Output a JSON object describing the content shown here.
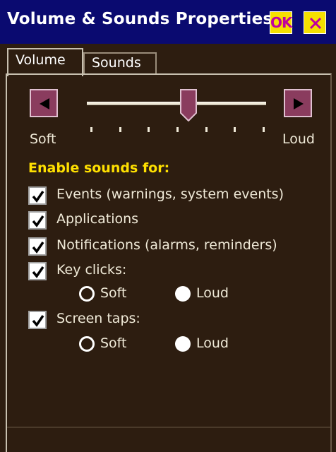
{
  "window": {
    "title": "Volume & Sounds Properties",
    "ok_label": "OK",
    "close_icon": "close-icon"
  },
  "tabs": [
    {
      "label": "Volume",
      "active": true
    },
    {
      "label": "Sounds",
      "active": false
    }
  ],
  "volume": {
    "soft_label": "Soft",
    "loud_label": "Loud",
    "level": 0.57,
    "tick_count": 7,
    "left_icon": "arrow-left-icon",
    "right_icon": "arrow-right-icon"
  },
  "enable_sounds": {
    "heading": "Enable sounds for:",
    "items": [
      {
        "label": "Events (warnings, system events)",
        "checked": true
      },
      {
        "label": "Applications",
        "checked": true
      },
      {
        "label": "Notifications (alarms, reminders)",
        "checked": true
      },
      {
        "label": "Key clicks:",
        "checked": true
      },
      {
        "label": "Screen taps:",
        "checked": true
      }
    ],
    "key_clicks": {
      "options": [
        "Soft",
        "Loud"
      ],
      "selected": "Loud"
    },
    "screen_taps": {
      "options": [
        "Soft",
        "Loud"
      ],
      "selected": "Loud"
    }
  },
  "colors": {
    "background": "#2d1d10",
    "titlebar": "#0a0a70",
    "heading": "#ffe000",
    "button_yellow": "#f5e000",
    "slider_accent": "#8a3c5e"
  }
}
